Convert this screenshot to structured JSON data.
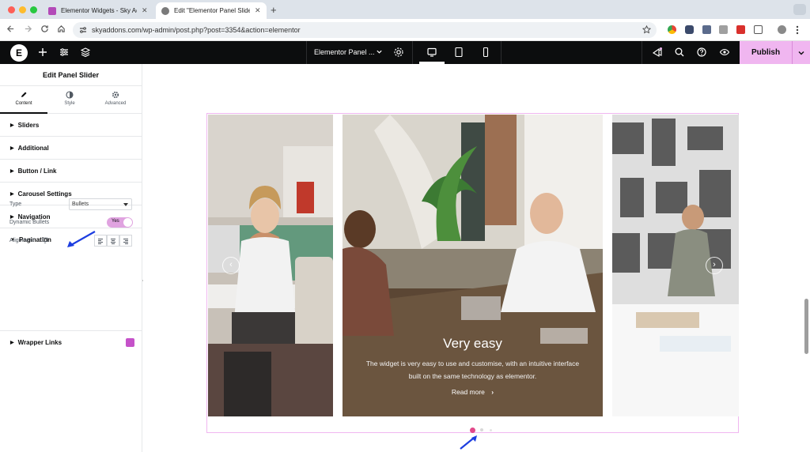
{
  "browser": {
    "tabs": [
      {
        "title": "Elementor Widgets - Sky Addo",
        "active": false
      },
      {
        "title": "Edit \"Elementor Panel Slider\"",
        "active": true
      }
    ],
    "url": "skyaddons.com/wp-admin/post.php?post=3354&action=elementor"
  },
  "editor": {
    "document_title": "Elementor Panel ...",
    "publish_label": "Publish"
  },
  "panel": {
    "title": "Edit Panel Slider",
    "tabs": [
      {
        "label": "Content",
        "icon": "pencil-icon"
      },
      {
        "label": "Style",
        "icon": "half-circle-icon"
      },
      {
        "label": "Advanced",
        "icon": "gear-icon"
      }
    ],
    "sections": {
      "sliders": "Sliders",
      "additional": "Additional",
      "button_link": "Button / Link",
      "carousel": "Carousel Settings",
      "navigation": "Navigation",
      "pagination": "Pagination",
      "wrapper": "Wrapper Links"
    },
    "pagination": {
      "type_label": "Type",
      "type_value": "Bullets",
      "dynamic_label": "Dynamic Bullets",
      "dynamic_value": "Yes",
      "alignment_label": "Alignment"
    }
  },
  "slider": {
    "title": "Very easy",
    "description": "The widget is very easy to use and customise, with an intuitive interface built on the same technology as elementor.",
    "button": "Read more",
    "active_bullet": 1,
    "bullet_count": 3
  },
  "colors": {
    "accent": "#f0b6f0",
    "bullet_active": "#e2498a",
    "annotation_arrow": "#1d3ee0"
  }
}
